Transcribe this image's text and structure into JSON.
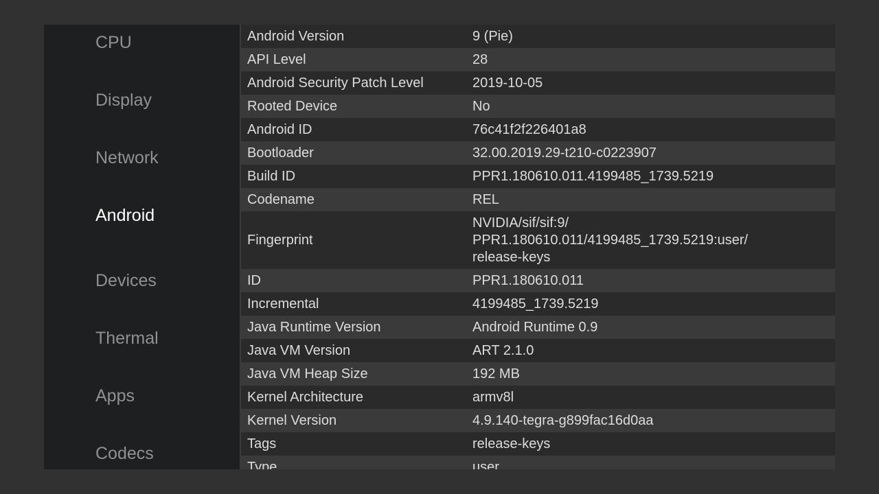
{
  "sidebar": {
    "items": [
      {
        "label": "CPU",
        "active": false
      },
      {
        "label": "Display",
        "active": false
      },
      {
        "label": "Network",
        "active": false
      },
      {
        "label": "Android",
        "active": true
      },
      {
        "label": "Devices",
        "active": false
      },
      {
        "label": "Thermal",
        "active": false
      },
      {
        "label": "Apps",
        "active": false
      },
      {
        "label": "Codecs",
        "active": false
      }
    ]
  },
  "details": {
    "rows": [
      {
        "key": "Android Version",
        "value": "9 (Pie)"
      },
      {
        "key": "API Level",
        "value": "28"
      },
      {
        "key": "Android Security Patch Level",
        "value": "2019-10-05"
      },
      {
        "key": "Rooted Device",
        "value": "No"
      },
      {
        "key": "Android ID",
        "value": "76c41f2f226401a8"
      },
      {
        "key": "Bootloader",
        "value": "32.00.2019.29-t210-c0223907"
      },
      {
        "key": "Build ID",
        "value": "PPR1.180610.011.4199485_1739.5219"
      },
      {
        "key": "Codename",
        "value": "REL"
      },
      {
        "key": "Fingerprint",
        "value": "NVIDIA/sif/sif:9/\nPPR1.180610.011/4199485_1739.5219:user/\nrelease-keys"
      },
      {
        "key": "ID",
        "value": "PPR1.180610.011"
      },
      {
        "key": "Incremental",
        "value": "4199485_1739.5219"
      },
      {
        "key": "Java Runtime Version",
        "value": "Android Runtime 0.9"
      },
      {
        "key": "Java VM Version",
        "value": "ART 2.1.0"
      },
      {
        "key": "Java VM Heap Size",
        "value": "192 MB"
      },
      {
        "key": "Kernel Architecture",
        "value": "armv8l"
      },
      {
        "key": "Kernel Version",
        "value": "4.9.140-tegra-g899fac16d0aa"
      },
      {
        "key": "Tags",
        "value": "release-keys"
      },
      {
        "key": "Type",
        "value": "user"
      }
    ]
  }
}
